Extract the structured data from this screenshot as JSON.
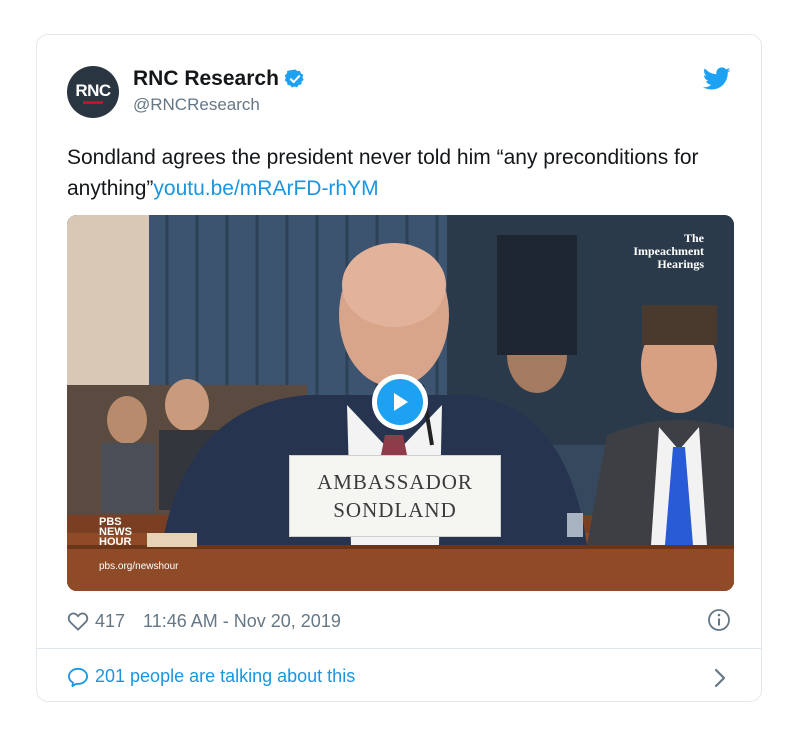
{
  "tweet": {
    "avatar_text": "RNC",
    "display_name": "RNC Research",
    "handle": "@RNCResearch",
    "text": "Sondland agrees the president never told him “any preconditions for anything”",
    "link": "youtu.be/mRArFD-rhYM",
    "icons": {
      "verified": "verified-badge-icon",
      "platform": "twitter-bird-icon",
      "like": "heart-icon",
      "info": "info-icon",
      "reply": "speech-bubble-icon",
      "chevron": "chevron-right-icon",
      "play": "play-icon"
    },
    "colors": {
      "accent": "#1da1f2",
      "link": "#1b95e0",
      "muted": "#657786"
    }
  },
  "media": {
    "nameplate_line1": "AMBASSADOR",
    "nameplate_line2": "SONDLAND",
    "watermark_line1": "The",
    "watermark_line2": "Impeachment",
    "watermark_line3": "Hearings",
    "pbs_line1": "PBS",
    "pbs_line2": "NEWS",
    "pbs_line3": "HOUR",
    "pbs_url": "pbs.org/newshour"
  },
  "meta": {
    "likes": "417",
    "timestamp": "11:46 AM - Nov 20, 2019"
  },
  "conversation": {
    "label": "201 people are talking about this"
  }
}
